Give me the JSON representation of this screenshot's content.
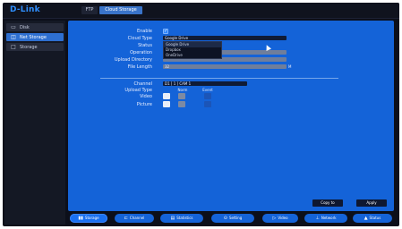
{
  "app": {
    "logo": "D-Link"
  },
  "top_tabs": [
    {
      "label": "FTP"
    },
    {
      "label": "Cloud Storage"
    }
  ],
  "sidebar": {
    "items": [
      {
        "label": "Disk",
        "icon": "disk-icon"
      },
      {
        "label": "Net Storage",
        "icon": "net-storage-icon",
        "active": true
      },
      {
        "label": "Storage",
        "icon": "storage-icon"
      }
    ]
  },
  "form": {
    "enable_label": "Enable",
    "cloud_type_label": "Cloud Type",
    "cloud_type_value": "Google Drive",
    "status_label": "Status",
    "operation_label": "Operation",
    "upload_directory_label": "Upload Directory",
    "file_length_label": "File Length",
    "file_length_value": "32",
    "file_length_unit": "M",
    "dropdown_options": [
      "Google Drive",
      "Dropbox",
      "OneDrive"
    ],
    "channel_label": "Channel",
    "channel_value": "D1 [ 1 ] CAM 1",
    "upload_type_label": "Upload Type",
    "video_label": "Video",
    "picture_label": "Picture",
    "col_normal": "Norm",
    "col_event": "Event"
  },
  "buttons": {
    "copy": "Copy to",
    "apply": "Apply"
  },
  "bottom_nav": [
    {
      "label": "Storage",
      "icon": "storage-nav-icon",
      "active": true
    },
    {
      "label": "Channel",
      "icon": "channel-icon"
    },
    {
      "label": "Statistics",
      "icon": "statistics-icon"
    },
    {
      "label": "Setting",
      "icon": "setting-icon"
    },
    {
      "label": "Video",
      "icon": "video-icon"
    },
    {
      "label": "Network",
      "icon": "network-icon"
    },
    {
      "label": "Status",
      "icon": "status-icon"
    }
  ],
  "colors": {
    "panel_blue": "#1463d8",
    "frame_dark": "#0c0f1a",
    "accent": "#2f8fff"
  }
}
